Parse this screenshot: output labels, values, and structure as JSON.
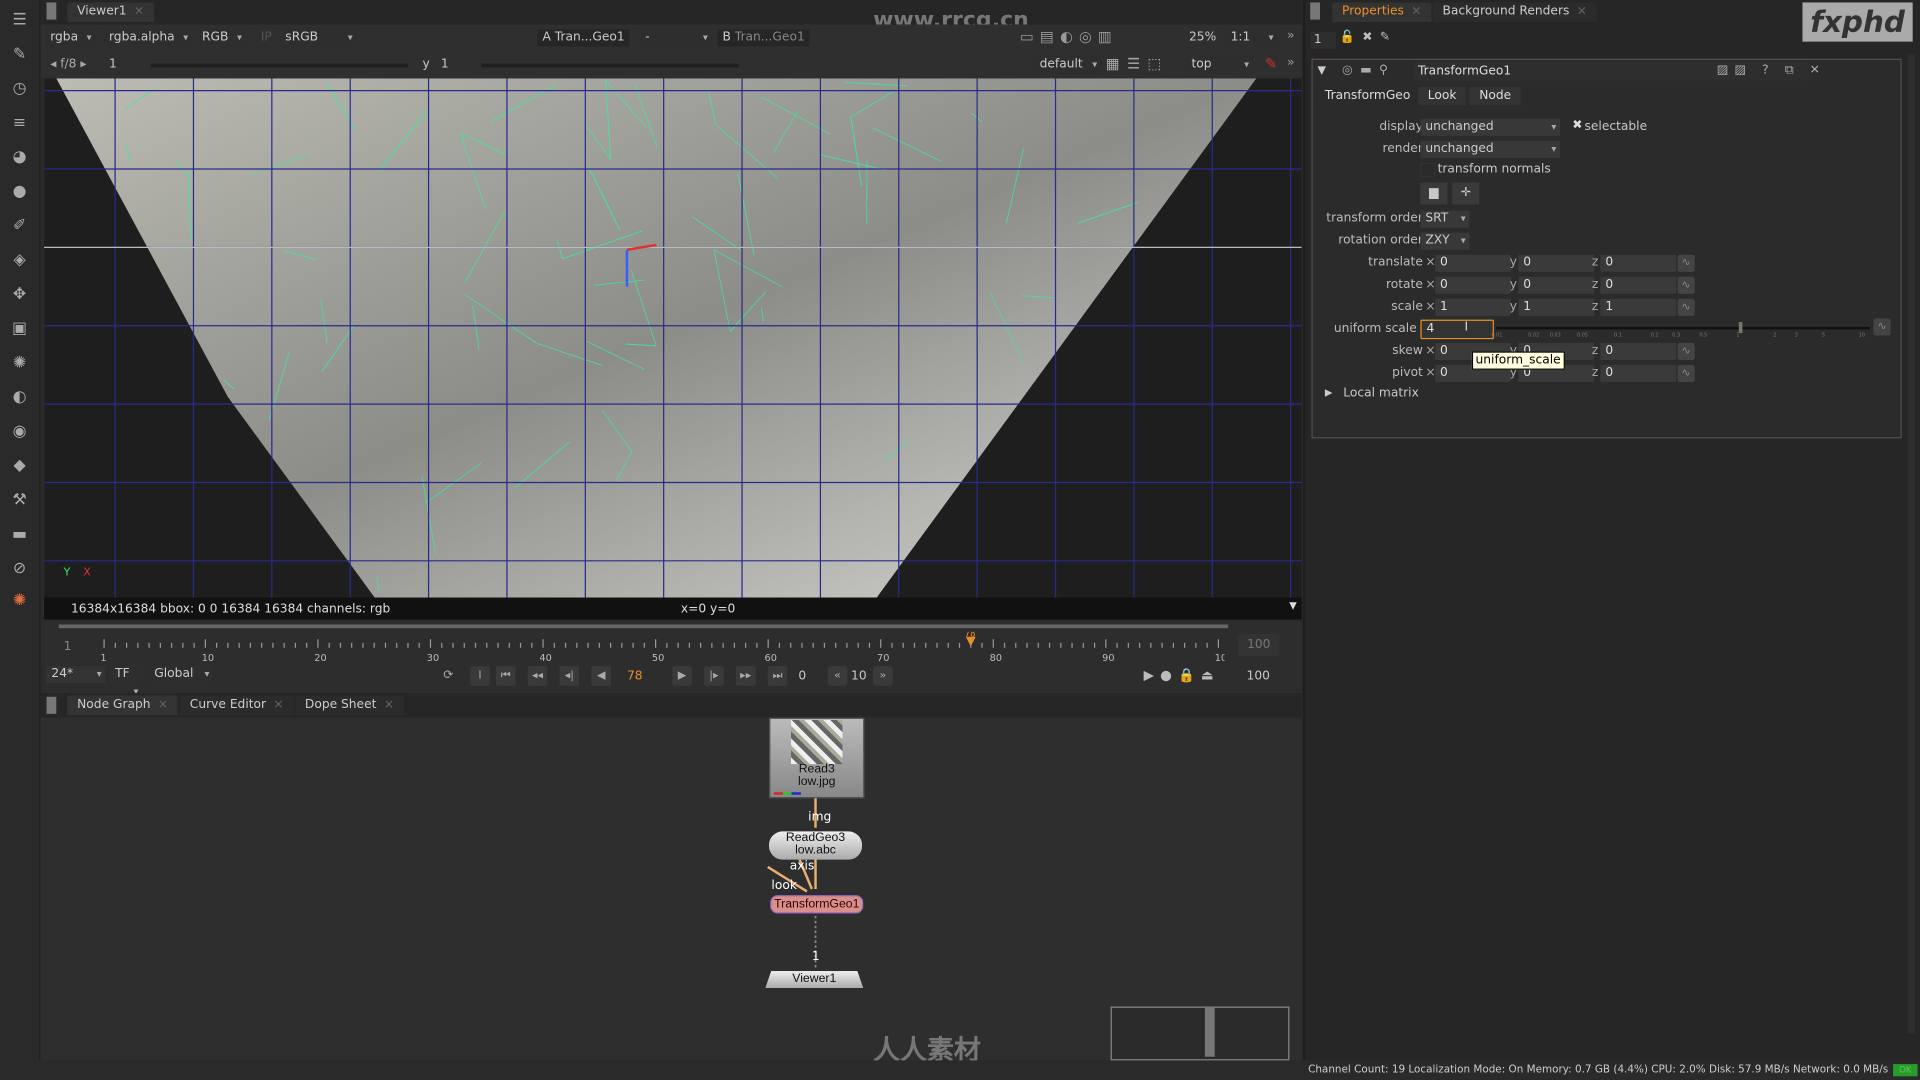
{
  "viewer": {
    "tab": "Viewer1",
    "channels": "rgba",
    "alpha_channel": "rgba.alpha",
    "display_channels": "RGB",
    "ip_label": "IP",
    "lut": "sRGB",
    "input_a_label": "A",
    "input_a": "Tran...Geo1",
    "compare": "-",
    "input_b_label": "B",
    "input_b": "Tran...Geo1",
    "zoom": "25%",
    "ratio": "1:1",
    "fstop": "f/8",
    "gain": "1",
    "gamma_label": "y",
    "gamma": "1",
    "camera_set": "default",
    "view": "top",
    "info": "16384x16384  bbox: 0 0 16384 16384 channels: rgb",
    "coords": "x=0 y=0",
    "axis_y": "Y",
    "axis_x": "X"
  },
  "timeline": {
    "start": "1",
    "end": "100",
    "end_field": "100",
    "current_frame": 78,
    "ticks": [
      "1",
      "10",
      "20",
      "30",
      "40",
      "50",
      "60",
      "70",
      "80",
      "90",
      "100"
    ],
    "fps": "24*",
    "tf": "TF",
    "scope": "Global",
    "frame_field": "78",
    "step": "10",
    "zero": "0",
    "in_label": "I",
    "out_field": "100"
  },
  "bottom_tabs": [
    {
      "label": "Node Graph"
    },
    {
      "label": "Curve Editor"
    },
    {
      "label": "Dope Sheet"
    }
  ],
  "nodes": {
    "read": {
      "name": "Read3",
      "file": "low.jpg"
    },
    "readgeo": {
      "name": "ReadGeo3",
      "file": "low.abc"
    },
    "transform": {
      "name": "TransformGeo1"
    },
    "viewer": {
      "name": "Viewer1"
    },
    "edge_img": "img",
    "edge_axis": "axis",
    "edge_look": "look",
    "edge_viewer": "1"
  },
  "properties": {
    "tabs": [
      {
        "label": "Properties"
      },
      {
        "label": "Background Renders"
      }
    ],
    "max_panels": "1",
    "node_name": "TransformGeo1",
    "node_tabs": [
      "TransformGeo",
      "Look",
      "Node"
    ],
    "display_label": "display",
    "display_value": "unchanged",
    "selectable_label": "selectable",
    "render_label": "render",
    "render_value": "unchanged",
    "transform_normals_label": "transform normals",
    "transform_order_label": "transform order",
    "transform_order": "SRT",
    "rotation_order_label": "rotation order",
    "rotation_order": "ZXY",
    "rows": [
      {
        "label": "translate",
        "x": "0",
        "y": "0",
        "z": "0"
      },
      {
        "label": "rotate",
        "x": "0",
        "y": "0",
        "z": "0"
      },
      {
        "label": "scale",
        "x": "1",
        "y": "1",
        "z": "1"
      }
    ],
    "uniform_scale_label": "uniform scale",
    "uniform_scale": "4",
    "slider_ticks": [
      "0.01",
      "0.02",
      "0.03",
      "0.05",
      "0.1",
      "0.2",
      "0.3",
      "0.5",
      "1",
      "2",
      "3",
      "5",
      "10"
    ],
    "rows2": [
      {
        "label": "skew",
        "x": "0",
        "y": "0",
        "z": "0"
      },
      {
        "label": "pivot",
        "x": "0",
        "y": "0",
        "z": "0"
      }
    ],
    "tooltip": "uniform_scale",
    "local_matrix": "Local matrix"
  },
  "status": "Channel Count: 19  Localization Mode: On  Memory: 0.7 GB (4.4%)  CPU: 2.0%  Disk: 57.9 MB/s  Network: 0.0 MB/s",
  "status_ok": "OK",
  "watermark": {
    "site": "www.rrcg.cn",
    "logo": "fxphd",
    "brand": "人人素材"
  },
  "colors": {
    "accent": "#e8902a",
    "mesh": "#3ee8a0",
    "grid": "#2a2a7a",
    "node_selected": "#d9908a"
  }
}
